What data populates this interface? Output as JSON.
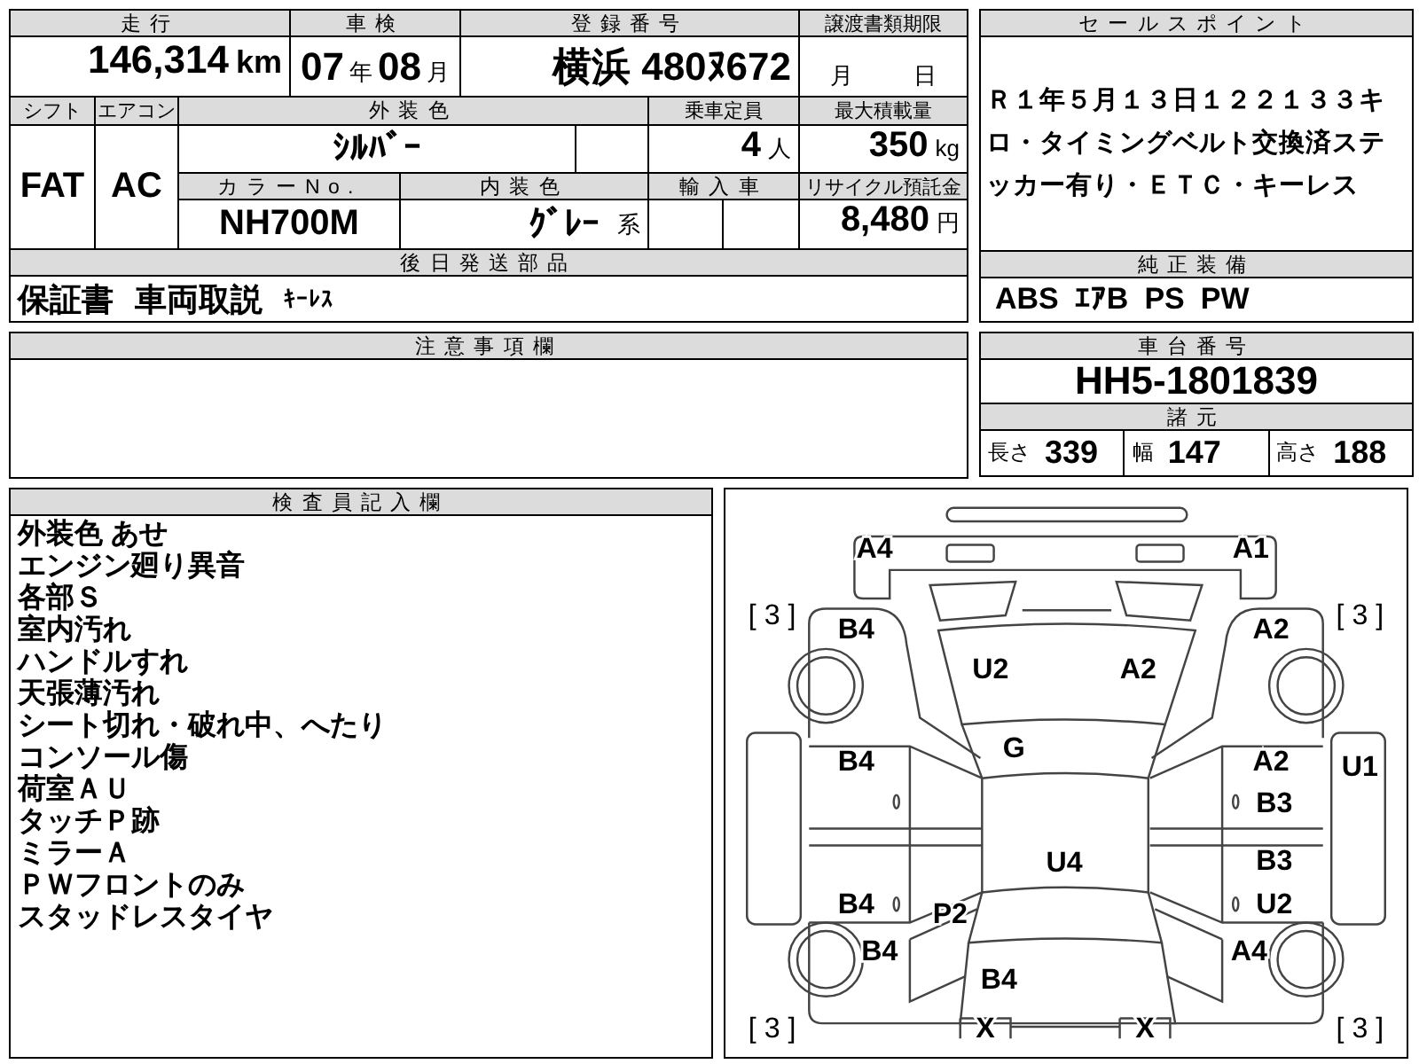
{
  "vehicle_table": {
    "mileage": {
      "label": "走行",
      "value": "146,314",
      "unit": "km"
    },
    "inspection": {
      "label": "車検",
      "year": "07",
      "year_unit": "年",
      "month": "08",
      "month_unit": "月"
    },
    "registration": {
      "label": "登録番号",
      "value": "横浜 480ﾇ672"
    },
    "transfer_deadline": {
      "label": "譲渡書類期限",
      "month_unit": "月",
      "day_unit": "日"
    },
    "shift": {
      "label": "シフト",
      "value": "FAT"
    },
    "aircon": {
      "label": "エアコン",
      "value": "AC"
    },
    "exterior_color": {
      "label": "外装色",
      "value": "ｼﾙﾊﾞｰ"
    },
    "capacity": {
      "label": "乗車定員",
      "value": "4",
      "unit": "人"
    },
    "max_load": {
      "label": "最大積載量",
      "value": "350",
      "unit": "kg"
    },
    "color_no": {
      "label": "カラーNo.",
      "value": "NH700M"
    },
    "interior_color": {
      "label": "内装色",
      "value": "ｸﾞﾚｰ",
      "unit": "系"
    },
    "imported": {
      "label": "輸入車"
    },
    "recycle_fee": {
      "label": "リサイクル預託金",
      "value": "8,480",
      "unit": "円"
    }
  },
  "later_parts": {
    "title": "後日発送部品",
    "items": [
      "保証書",
      "車両取説",
      "ｷｰﾚｽ"
    ]
  },
  "notes": {
    "title": "注意事項欄"
  },
  "sales_point": {
    "title": "セールスポイント",
    "text": "Ｒ１年５月１３日１２２１３３キロ・タイミングベルト交換済ステッカー有り・ＥＴＣ・キーレス"
  },
  "equipment": {
    "title": "純正装備",
    "items": [
      "ABS",
      "ｴｱB",
      "PS",
      "PW"
    ]
  },
  "chassis": {
    "title": "車台番号",
    "value": "HH5-1801839"
  },
  "specs": {
    "title": "諸元",
    "items": [
      {
        "label": "長さ",
        "value": "339"
      },
      {
        "label": "幅",
        "value": "147"
      },
      {
        "label": "高さ",
        "value": "188"
      }
    ]
  },
  "inspector_notes": {
    "title": "検査員記入欄",
    "lines": [
      "外装色 あせ",
      "エンジン廻り異音",
      "各部Ｓ",
      "室内汚れ",
      "ハンドルすれ",
      "天張薄汚れ",
      "シート切れ・破れ中、へたり",
      "コンソール傷",
      "荷室ＡＵ",
      "タッチＰ跡",
      "ミラーＡ",
      "ＰＷフロントのみ",
      "スタッドレスタイヤ"
    ]
  },
  "diagram": {
    "tires": [
      "[ 3 ]",
      "[ 3 ]",
      "[ 3 ]",
      "[ 3 ]"
    ],
    "marks": [
      "A4",
      "A1",
      "B4",
      "A2",
      "U2",
      "A2",
      "G",
      "B4",
      "A2",
      "U1",
      "B3",
      "U4",
      "B3",
      "B4",
      "P2",
      "U2",
      "B4",
      "A4",
      "B4",
      "X",
      "X"
    ]
  }
}
